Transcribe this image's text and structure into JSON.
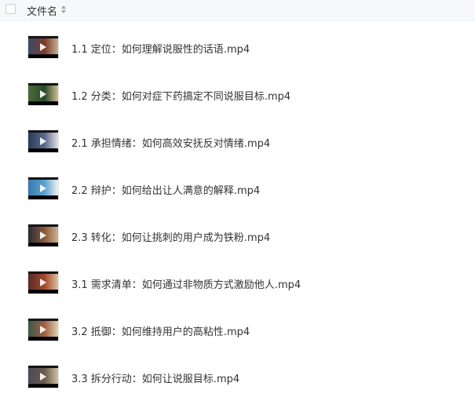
{
  "header": {
    "column_name": "文件名"
  },
  "files": [
    {
      "name": "1.1 定位：如何理解说服性的话语.mp4",
      "icon": "video-thumbnail"
    },
    {
      "name": "1.2 分类：如何对症下药搞定不同说服目标.mp4",
      "icon": "video-thumbnail"
    },
    {
      "name": "2.1 承担情绪：如何高效安抚反对情绪.mp4",
      "icon": "video-thumbnail"
    },
    {
      "name": "2.2 辩护：如何给出让人满意的解释.mp4",
      "icon": "video-thumbnail"
    },
    {
      "name": "2.3 转化：如何让挑刺的用户成为铁粉.mp4",
      "icon": "video-thumbnail"
    },
    {
      "name": "3.1 需求清单：如何通过非物质方式激励他人.mp4",
      "icon": "video-thumbnail"
    },
    {
      "name": "3.2 抵御：如何维持用户的高粘性.mp4",
      "icon": "video-thumbnail"
    },
    {
      "name": "3.3 拆分行动：如何让说服目标.mp4",
      "icon": "video-thumbnail"
    }
  ]
}
